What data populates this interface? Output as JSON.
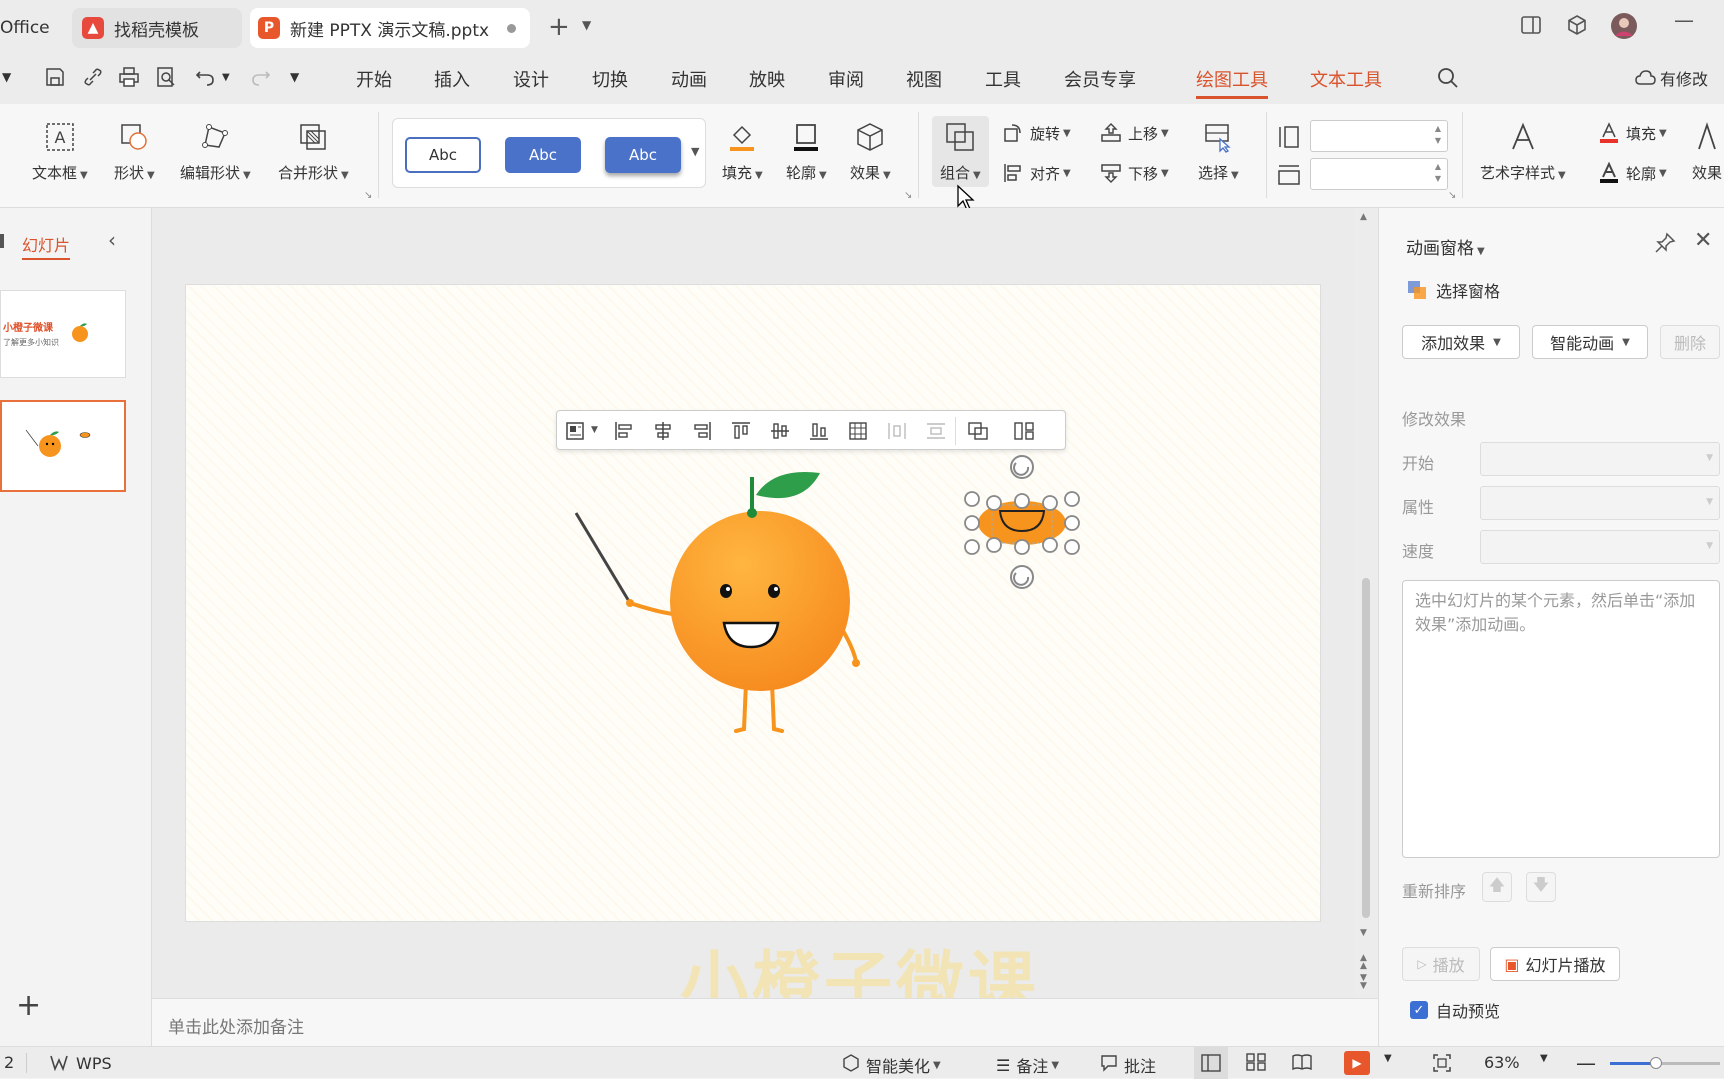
{
  "tabs": {
    "office": "Office",
    "template": "找稻壳模板",
    "doc": "新建 PPTX 演示文稿.pptx",
    "template_icon": "W",
    "doc_icon": "P"
  },
  "menu": {
    "items": [
      "开始",
      "插入",
      "设计",
      "切换",
      "动画",
      "放映",
      "审阅",
      "视图",
      "工具",
      "会员专享"
    ],
    "drawing_tools": "绘图工具",
    "text_tools": "文本工具",
    "modified": "有修改"
  },
  "ribbon": {
    "textbox": "文本框",
    "shape": "形状",
    "edit_shape": "编辑形状",
    "merge_shape": "合并形状",
    "style1": "Abc",
    "style2": "Abc",
    "style3": "Abc",
    "fill": "填充",
    "outline": "轮廓",
    "effect": "效果",
    "group": "组合",
    "rotate": "旋转",
    "align": "对齐",
    "move_up": "上移",
    "move_down": "下移",
    "select": "选择",
    "art_style": "艺术字样式",
    "text_fill": "填充",
    "text_outline": "轮廓",
    "text_effect": "效果"
  },
  "left_panel": {
    "tab_label": "幻灯片",
    "thumb1_title": "小橙子微课",
    "thumb1_sub": "了解更多小知识",
    "add": "+"
  },
  "notes": {
    "placeholder": "单击此处添加备注"
  },
  "right_panel": {
    "title": "动画窗格",
    "select_pane": "选择窗格",
    "add_effect": "添加效果",
    "smart_anim": "智能动画",
    "delete": "删除",
    "modify_effect": "修改效果",
    "start": "开始",
    "property": "属性",
    "speed": "速度",
    "hint": "选中幻灯片的某个元素，然后单击“添加效果”添加动画。",
    "reorder": "重新排序",
    "play": "播放",
    "slide_play": "幻灯片播放",
    "auto_preview": "自动预览"
  },
  "status": {
    "slide_num": "2",
    "wps": "WPS",
    "smart_beautify": "智能美化",
    "notes": "备注",
    "comments": "批注",
    "zoom": "63%"
  },
  "watermark": "小橙子微课",
  "colors": {
    "accent": "#d9532c",
    "orange": "#f7941d",
    "leaf": "#2e9e4a",
    "blue_style": "#4a72c9"
  }
}
